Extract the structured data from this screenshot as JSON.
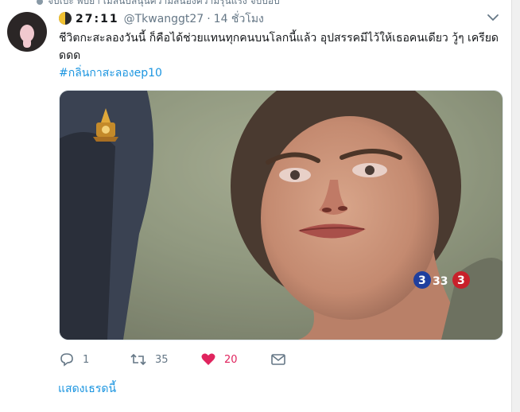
{
  "context_line": "จับเบะ พับยา เมลนบลนุนความสนองความรุนแรง จบบอบ",
  "tweet": {
    "display_name": "27:11",
    "handle": "@Tkwanggt27",
    "separator": "·",
    "time": "14 ชั่วโมง",
    "text": "ชีวิตกะสะลองวันนี้ ก็คือได้ช่วยแทนทุกคนบนโลกนี้แล้ว อุปสรรคมีไว้ให้เธอคนเดียว วู้ๆ เครียดดดด",
    "hashtag": "#กลิ่นกาสะลองep10",
    "media_logo_text": "33"
  },
  "actions": {
    "reply_count": "1",
    "retweet_count": "35",
    "like_count": "20"
  },
  "show_thread_label": "แสดงเธรดนี้",
  "colors": {
    "accent": "#1b95e0",
    "like": "#e0245e",
    "muted": "#657786"
  }
}
